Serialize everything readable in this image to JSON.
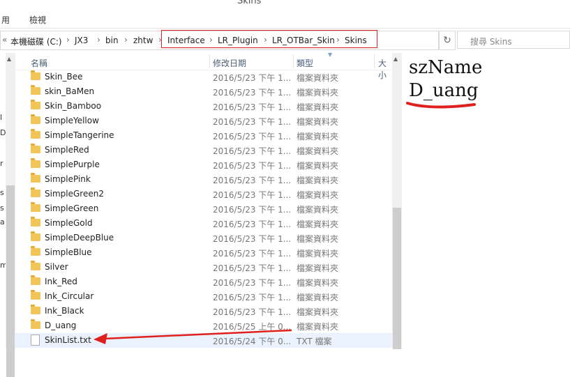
{
  "window": {
    "title": "Skins"
  },
  "menu": {
    "items": [
      "用",
      "檢視"
    ]
  },
  "address": {
    "overflow": "«",
    "crumbs": [
      "本機磁碟 (C:)",
      "JX3",
      "bin",
      "zhtw",
      "Interface",
      "LR_Plugin",
      "LR_OTBar_Skin",
      "Skins"
    ],
    "separator": "›",
    "refresh_icon": "↻",
    "search_placeholder": "搜尋 Skins"
  },
  "columns": {
    "name": "名稱",
    "date": "修改日期",
    "type": "類型",
    "size": "大小"
  },
  "rows": [
    {
      "name": "Skin_Bee",
      "date": "2016/5/23 下午 1...",
      "type": "檔案資料夾",
      "kind": "folder"
    },
    {
      "name": "skin_BaMen",
      "date": "2016/5/23 下午 1...",
      "type": "檔案資料夾",
      "kind": "folder"
    },
    {
      "name": "Skin_Bamboo",
      "date": "2016/5/23 下午 1...",
      "type": "檔案資料夾",
      "kind": "folder"
    },
    {
      "name": "SimpleYellow",
      "date": "2016/5/23 下午 1...",
      "type": "檔案資料夾",
      "kind": "folder"
    },
    {
      "name": "SimpleTangerine",
      "date": "2016/5/23 下午 1...",
      "type": "檔案資料夾",
      "kind": "folder"
    },
    {
      "name": "SimpleRed",
      "date": "2016/5/23 下午 1...",
      "type": "檔案資料夾",
      "kind": "folder"
    },
    {
      "name": "SimplePurple",
      "date": "2016/5/23 下午 1...",
      "type": "檔案資料夾",
      "kind": "folder"
    },
    {
      "name": "SimplePink",
      "date": "2016/5/23 下午 1...",
      "type": "檔案資料夾",
      "kind": "folder"
    },
    {
      "name": "SimpleGreen2",
      "date": "2016/5/23 下午 1...",
      "type": "檔案資料夾",
      "kind": "folder"
    },
    {
      "name": "SimpleGreen",
      "date": "2016/5/23 下午 1...",
      "type": "檔案資料夾",
      "kind": "folder"
    },
    {
      "name": "SimpleGold",
      "date": "2016/5/23 下午 1...",
      "type": "檔案資料夾",
      "kind": "folder"
    },
    {
      "name": "SimpleDeepBlue",
      "date": "2016/5/23 下午 1...",
      "type": "檔案資料夾",
      "kind": "folder"
    },
    {
      "name": "SimpleBlue",
      "date": "2016/5/23 下午 1...",
      "type": "檔案資料夾",
      "kind": "folder"
    },
    {
      "name": "Silver",
      "date": "2016/5/23 下午 1...",
      "type": "檔案資料夾",
      "kind": "folder"
    },
    {
      "name": "Ink_Red",
      "date": "2016/5/23 下午 1...",
      "type": "檔案資料夾",
      "kind": "folder"
    },
    {
      "name": "Ink_Circular",
      "date": "2016/5/23 下午 1...",
      "type": "檔案資料夾",
      "kind": "folder"
    },
    {
      "name": "Ink_Black",
      "date": "2016/5/23 下午 1...",
      "type": "檔案資料夾",
      "kind": "folder"
    },
    {
      "name": "D_uang",
      "date": "2016/5/25 上午 0...",
      "type": "檔案資料夾",
      "kind": "folder"
    },
    {
      "name": "SkinList.txt",
      "date": "2016/5/24 下午 0...",
      "type": "TXT 檔案",
      "kind": "file"
    }
  ],
  "nav_fragments": [
    "l",
    "D",
    "r",
    "s",
    "s",
    "a",
    "m"
  ],
  "annotation": {
    "line1": "szName",
    "line2": "D_uang"
  },
  "colors": {
    "highlight": "#e0201c"
  }
}
